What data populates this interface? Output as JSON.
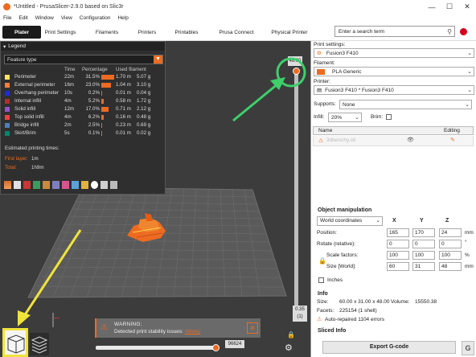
{
  "window": {
    "title": "*Untitled - PrusaSlicer-2.9.0 based on Slic3r",
    "min": "—",
    "max": "☐",
    "close": "✕"
  },
  "menu": [
    "File",
    "Edit",
    "Window",
    "View",
    "Configuration",
    "Help"
  ],
  "tabs": [
    "Plater",
    "Print Settings",
    "Filaments",
    "Printers",
    "Printables",
    "Prusa Connect",
    "Physical Printer"
  ],
  "search": {
    "placeholder": "Enter a search term"
  },
  "legend": {
    "title": "Legend",
    "view_type": "Feature type",
    "columns": {
      "time": "Time",
      "percentage": "Percentage",
      "used": "Used filament"
    },
    "rows": [
      {
        "name": "Perimeter",
        "time": "22m",
        "pct": "31.5%",
        "pct_value": 31.5,
        "mm": "1.70 m",
        "g": "5.07 g",
        "color": "#ffe45c"
      },
      {
        "name": "External perimeter",
        "time": "16m",
        "pct": "23.0%",
        "pct_value": 23.0,
        "mm": "1.04 m",
        "g": "3.10 g",
        "color": "#ff7d38"
      },
      {
        "name": "Overhang perimeter",
        "time": "10s",
        "pct": "0.2%",
        "pct_value": 0.2,
        "mm": "0.01 m",
        "g": "0.04 g",
        "color": "#1f2bdc"
      },
      {
        "name": "Internal infill",
        "time": "4m",
        "pct": "5.2%",
        "pct_value": 5.2,
        "mm": "0.58 m",
        "g": "1.72 g",
        "color": "#b03029"
      },
      {
        "name": "Solid infill",
        "time": "12m",
        "pct": "17.0%",
        "pct_value": 17.0,
        "mm": "0.71 m",
        "g": "2.12 g",
        "color": "#9654cc"
      },
      {
        "name": "Top solid infill",
        "time": "4m",
        "pct": "6.2%",
        "pct_value": 6.2,
        "mm": "0.16 m",
        "g": "0.48 g",
        "color": "#f04040"
      },
      {
        "name": "Bridge infill",
        "time": "2m",
        "pct": "2.5%",
        "pct_value": 2.5,
        "mm": "0.23 m",
        "g": "0.69 g",
        "color": "#4d80ba"
      },
      {
        "name": "Skirt/Brim",
        "time": "5s",
        "pct": "0.1%",
        "pct_value": 0.1,
        "mm": "0.01 m",
        "g": "0.02 g",
        "color": "#00876e"
      }
    ],
    "estimated_label": "Estimated printing times:",
    "first_layer_label": "First layer:",
    "first_layer_value": "1m",
    "total_label": "Total:",
    "total_value": "1h9m"
  },
  "viewport": {
    "vslider_top": "48.00",
    "vslider_bottom": "0.35",
    "vslider_bottom_sub": "(1)",
    "hslider_value": "96624",
    "warning_title": "WARNING:",
    "warning_text": "Detected print stability issues:",
    "warning_link": "(More)"
  },
  "right_panel": {
    "print_settings_label": "Print settings:",
    "print_settings_value": "Fusion3 F410",
    "filament_label": "Filament:",
    "filament_value": "PLA Generic",
    "filament_color": "#ed6b21",
    "printer_label": "Printer:",
    "printer_value": "Fusion3 F410 * Fusion3 F410",
    "supports_label": "Supports:",
    "supports_value": "None",
    "infill_label": "Infill:",
    "infill_value": "20%",
    "brim_label": "Brim:",
    "object_name_header": "Name",
    "object_editing_header": "Editing",
    "object_name": "3dbenchy.stl",
    "object_manipulation_title": "Object manipulation",
    "coord_system": "World coordinates",
    "axis_x": "X",
    "axis_y": "Y",
    "axis_z": "Z",
    "position_label": "Position:",
    "position": [
      "165",
      "170",
      "24"
    ],
    "position_unit": "mm",
    "rotate_label": "Rotate (relative):",
    "rotate": [
      "0",
      "0",
      "0"
    ],
    "rotate_unit": "°",
    "scale_label": "Scale factors:",
    "scale": [
      "100",
      "100",
      "100"
    ],
    "scale_unit": "%",
    "size_label": "Size [World]:",
    "size": [
      "60",
      "31",
      "48"
    ],
    "size_unit": "mm",
    "inches_label": "Inches",
    "info_title": "Info",
    "info_size_label": "Size:",
    "info_size_value": "60.00 x 31.00 x 48.00",
    "info_volume_label": "Volume:",
    "info_volume_value": "15550.38",
    "info_facets_label": "Facets:",
    "info_facets_value": "225154 (1 shell)",
    "info_repaired": "Auto-repaired 1104 errors",
    "sliced_info_title": "Sliced Info",
    "export_button": "Export G-code"
  }
}
